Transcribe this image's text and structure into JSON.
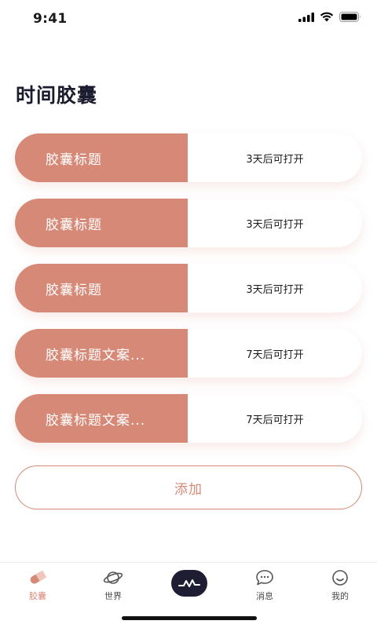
{
  "status_bar": {
    "time": "9:41"
  },
  "page": {
    "title": "时间胶囊"
  },
  "capsules": [
    {
      "title": "胶囊标题",
      "status": "3天后可打开"
    },
    {
      "title": "胶囊标题",
      "status": "3天后可打开"
    },
    {
      "title": "胶囊标题",
      "status": "3天后可打开"
    },
    {
      "title": "胶囊标题文案...",
      "status": "7天后可打开"
    },
    {
      "title": "胶囊标题文案...",
      "status": "7天后可打开"
    }
  ],
  "add_button": {
    "label": "添加"
  },
  "tab_bar": {
    "items": [
      {
        "label": "胶囊",
        "icon": "capsule-icon",
        "active": true
      },
      {
        "label": "世界",
        "icon": "planet-icon",
        "active": false
      },
      {
        "label": "",
        "icon": "pulse-icon",
        "active": false
      },
      {
        "label": "消息",
        "icon": "chat-bubble-icon",
        "active": false
      },
      {
        "label": "我的",
        "icon": "smiley-icon",
        "active": false
      }
    ]
  },
  "colors": {
    "accent": "#d78977",
    "center_button": "#1e1d33",
    "title": "#1b1b2e"
  }
}
